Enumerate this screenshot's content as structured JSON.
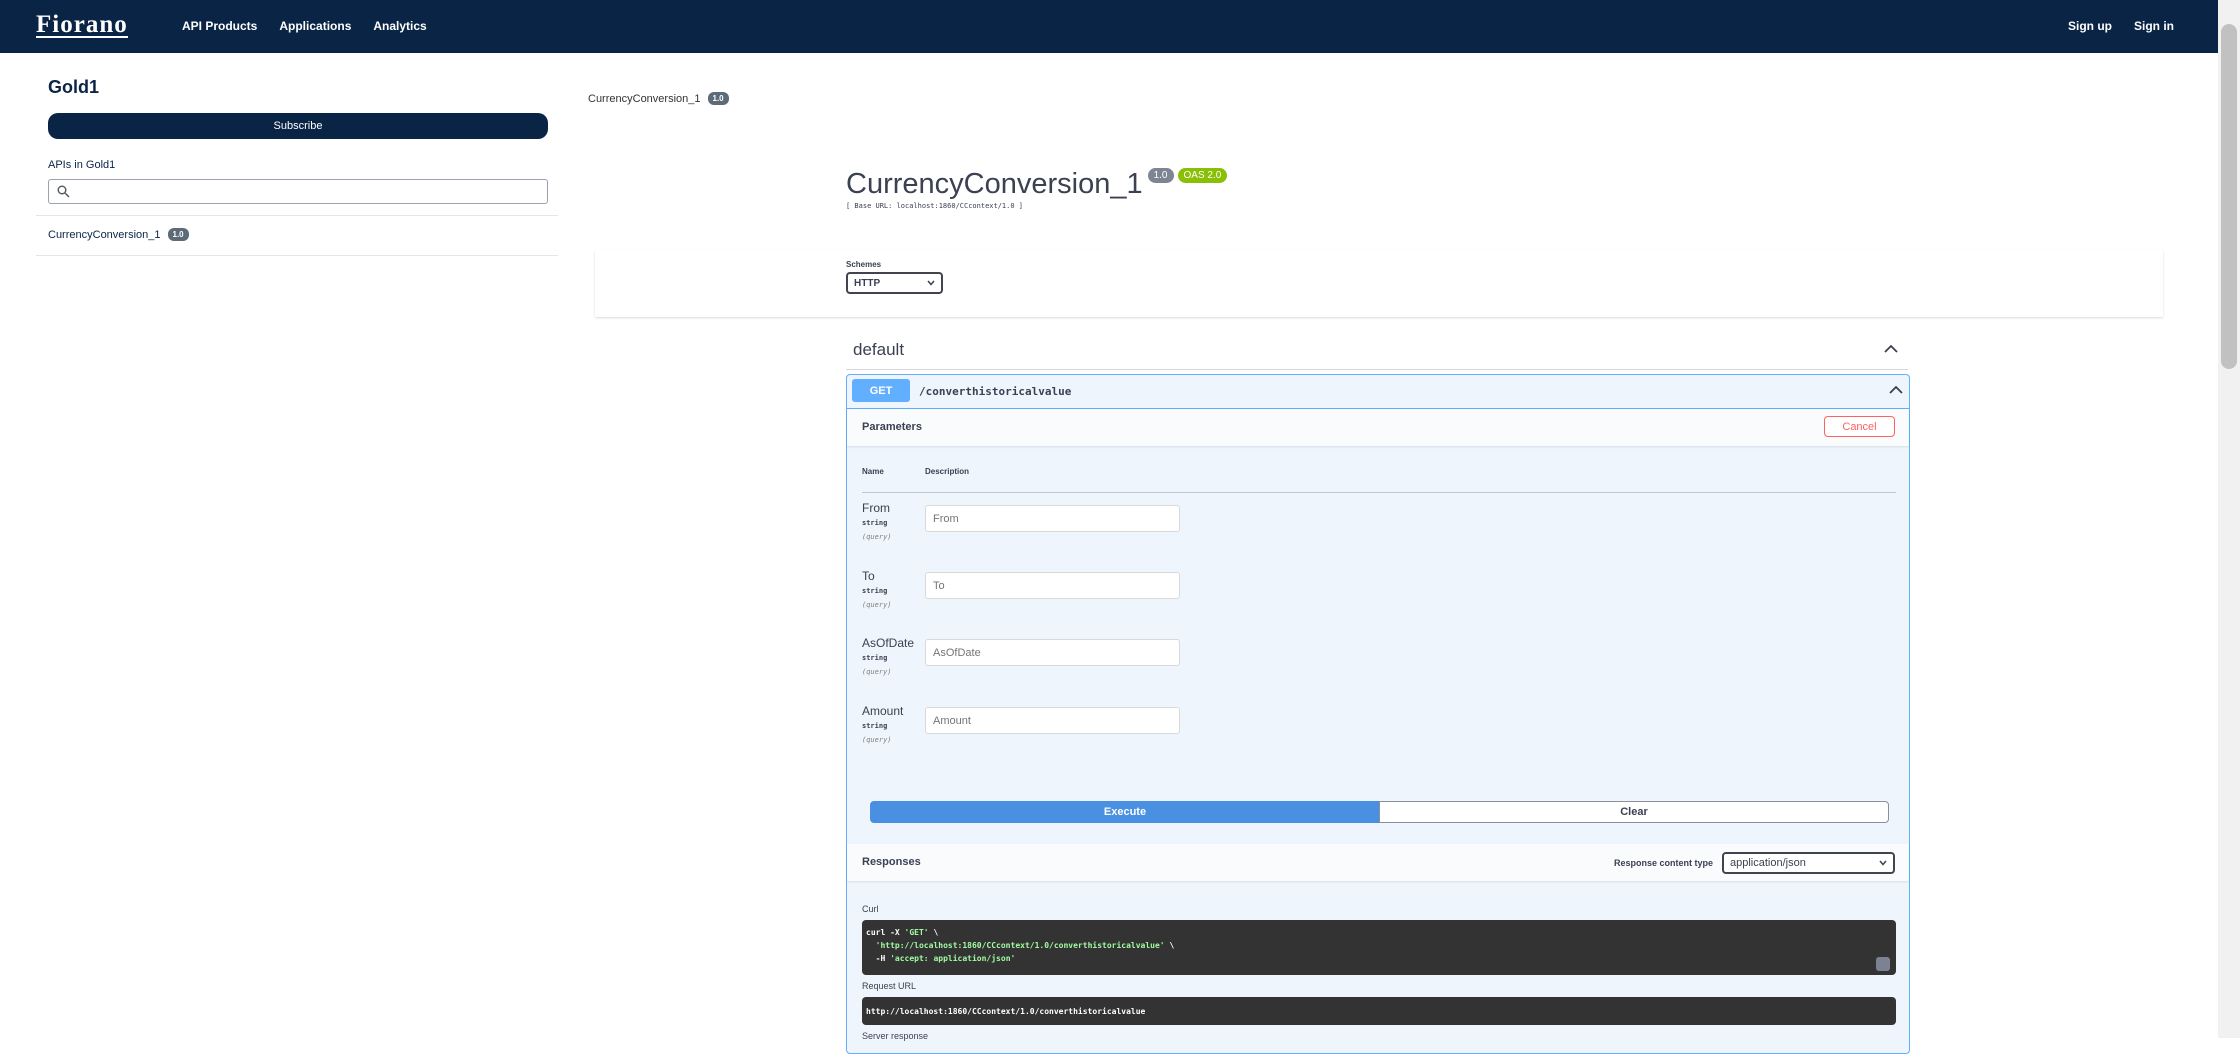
{
  "nav": {
    "logo": "Fiorano",
    "items": [
      "API Products",
      "Applications",
      "Analytics"
    ],
    "sign_up": "Sign up",
    "sign_in": "Sign in"
  },
  "sidebar": {
    "plan_title": "Gold1",
    "subscribe": "Subscribe",
    "apis_label": "APIs in Gold1",
    "search_placeholder": "",
    "api_item": {
      "name": "CurrencyConversion_1",
      "version": "1.0"
    }
  },
  "breadcrumb": {
    "name": "CurrencyConversion_1",
    "version": "1.0"
  },
  "api": {
    "title": "CurrencyConversion_1",
    "version": "1.0",
    "oas": "OAS 2.0",
    "base_url": "[ Base URL: localhost:1860/CCcontext/1.0 ]",
    "colors": {
      "version_badge": "#7d8492",
      "oas_badge": "#89bf04"
    }
  },
  "schemes": {
    "label": "Schemes",
    "value": "HTTP"
  },
  "tag": {
    "name": "default"
  },
  "operation": {
    "method": "GET",
    "path": "/converthistoricalvalue",
    "parameters_label": "Parameters",
    "cancel": "Cancel",
    "col_name": "Name",
    "col_description": "Description",
    "params": [
      {
        "name": "From",
        "type": "string",
        "in": "(query)",
        "placeholder": "From"
      },
      {
        "name": "To",
        "type": "string",
        "in": "(query)",
        "placeholder": "To"
      },
      {
        "name": "AsOfDate",
        "type": "string",
        "in": "(query)",
        "placeholder": "AsOfDate"
      },
      {
        "name": "Amount",
        "type": "string",
        "in": "(query)",
        "placeholder": "Amount"
      }
    ],
    "execute": "Execute",
    "clear": "Clear",
    "responses_label": "Responses",
    "response_content_type_label": "Response content type",
    "response_content_type": "application/json",
    "curl_label": "Curl",
    "curl_line1_a": "curl -X ",
    "curl_line1_b": "'GET'",
    "curl_line1_c": " \\",
    "curl_line2_a": "  ",
    "curl_line2_b": "'http://localhost:1860/CCcontext/1.0/converthistoricalvalue'",
    "curl_line2_c": " \\",
    "curl_line3_a": "  -H ",
    "curl_line3_b": "'accept: application/json'",
    "request_url_label": "Request URL",
    "request_url": "http://localhost:1860/CCcontext/1.0/converthistoricalvalue",
    "server_response_label": "Server response"
  }
}
